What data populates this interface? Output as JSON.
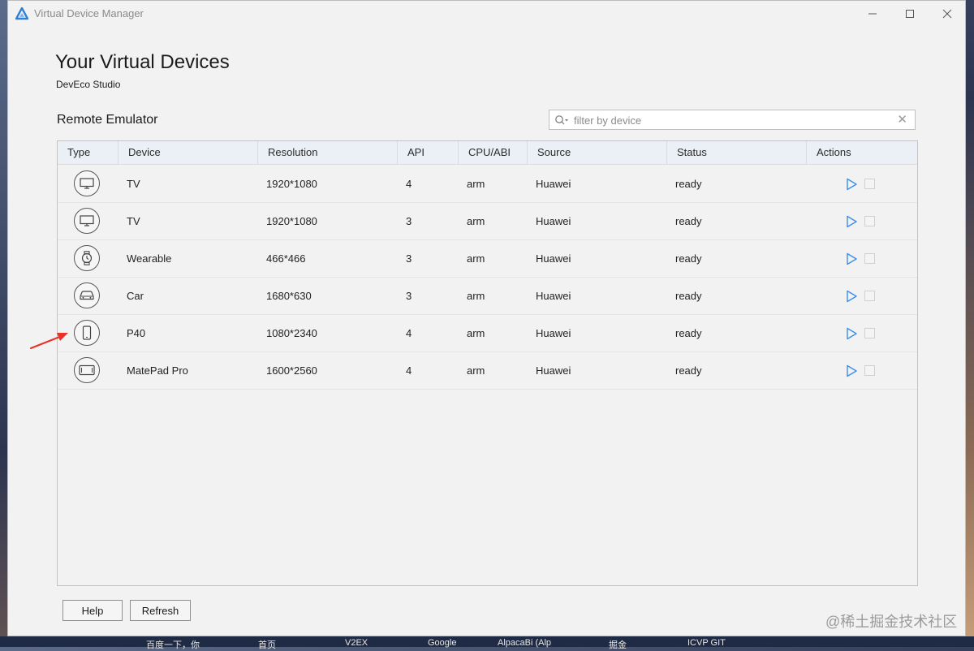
{
  "window": {
    "title": "Virtual Device Manager",
    "controls": [
      "minimize",
      "maximize",
      "close"
    ]
  },
  "header": {
    "title": "Your Virtual Devices",
    "subtitle": "DevEco Studio"
  },
  "section": {
    "title": "Remote Emulator"
  },
  "filter": {
    "placeholder": "filter by device",
    "value": ""
  },
  "table": {
    "columns": [
      "Type",
      "Device",
      "Resolution",
      "API",
      "CPU/ABI",
      "Source",
      "Status",
      "Actions"
    ],
    "rows": [
      {
        "type_icon": "tv-icon",
        "device": "TV",
        "resolution": "1920*1080",
        "api": "4",
        "cpu": "arm",
        "source": "Huawei",
        "status": "ready"
      },
      {
        "type_icon": "tv-icon",
        "device": "TV",
        "resolution": "1920*1080",
        "api": "3",
        "cpu": "arm",
        "source": "Huawei",
        "status": "ready"
      },
      {
        "type_icon": "watch-icon",
        "device": "Wearable",
        "resolution": "466*466",
        "api": "3",
        "cpu": "arm",
        "source": "Huawei",
        "status": "ready"
      },
      {
        "type_icon": "car-icon",
        "device": "Car",
        "resolution": "1680*630",
        "api": "3",
        "cpu": "arm",
        "source": "Huawei",
        "status": "ready"
      },
      {
        "type_icon": "phone-icon",
        "device": "P40",
        "resolution": "1080*2340",
        "api": "4",
        "cpu": "arm",
        "source": "Huawei",
        "status": "ready"
      },
      {
        "type_icon": "tablet-icon",
        "device": "MatePad Pro",
        "resolution": "1600*2560",
        "api": "4",
        "cpu": "arm",
        "source": "Huawei",
        "status": "ready"
      }
    ]
  },
  "buttons": {
    "help": "Help",
    "refresh": "Refresh"
  },
  "watermark": "@稀土掘金技术社区",
  "taskbar": [
    "百度一下，你",
    "首页",
    "V2EX",
    "Google",
    "AlpacaBi (Alp",
    "掘金",
    "ICVP GIT"
  ],
  "colors": {
    "accent": "#3b8ee8",
    "arrow": "#e8332a",
    "header_bg": "#eaf0f6",
    "window_bg": "#f2f2f2"
  }
}
